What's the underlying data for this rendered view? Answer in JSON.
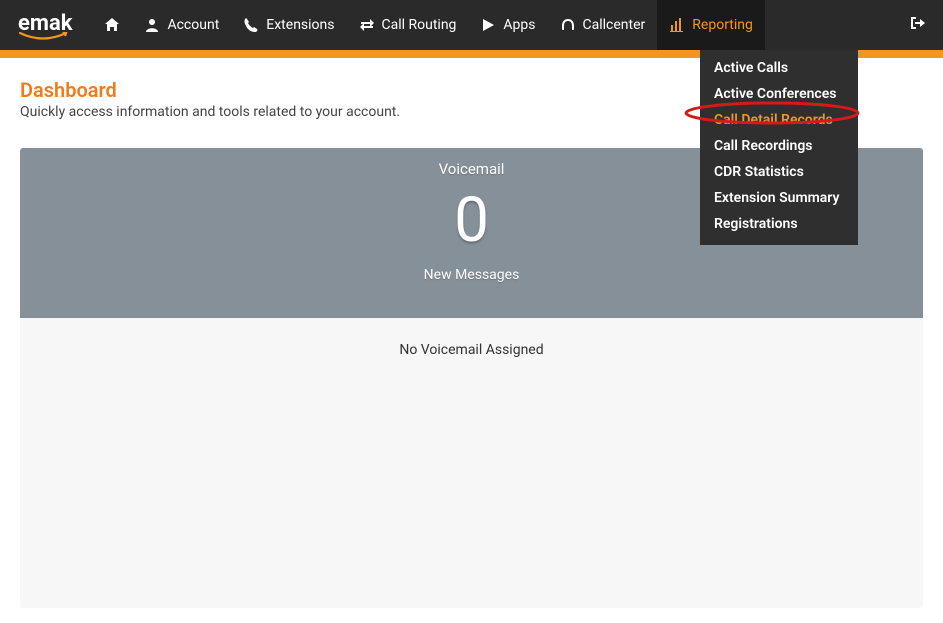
{
  "logo": {
    "text": "emak"
  },
  "nav": {
    "home": "",
    "account": "Account",
    "extensions": "Extensions",
    "callrouting": "Call Routing",
    "apps": "Apps",
    "callcenter": "Callcenter",
    "reporting": "Reporting"
  },
  "dropdown": {
    "activecalls": "Active Calls",
    "activeconferences": "Active Conferences",
    "cdr": "Call Detail Records",
    "callrecordings": "Call Recordings",
    "cdrstats": "CDR Statistics",
    "extsummary": "Extension Summary",
    "registrations": "Registrations"
  },
  "page": {
    "title": "Dashboard",
    "subtitle": "Quickly access information and tools related to your account."
  },
  "voicemail": {
    "header": "Voicemail",
    "count": "0",
    "label": "New Messages",
    "empty": "No Voicemail Assigned"
  }
}
